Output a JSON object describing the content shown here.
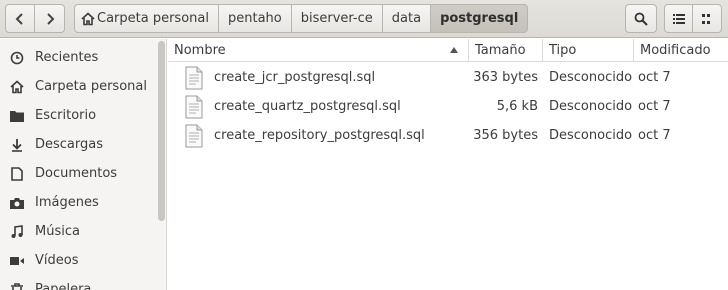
{
  "nav": {
    "back_icon": "chevron-left-icon",
    "forward_icon": "chevron-right-icon"
  },
  "path": [
    {
      "label": "Carpeta personal",
      "icon": "home-icon"
    },
    {
      "label": "pentaho"
    },
    {
      "label": "biserver-ce"
    },
    {
      "label": "data"
    },
    {
      "label": "postgresql"
    }
  ],
  "toolbar": {
    "search_icon": "search-icon",
    "list_icon": "list-view-icon",
    "menu_icon": "view-menu-icon"
  },
  "sidebar": {
    "items": [
      {
        "label": "Recientes",
        "icon": "clock-icon"
      },
      {
        "label": "Carpeta personal",
        "icon": "home-icon"
      },
      {
        "label": "Escritorio",
        "icon": "folder-icon"
      },
      {
        "label": "Descargas",
        "icon": "download-icon"
      },
      {
        "label": "Documentos",
        "icon": "document-icon"
      },
      {
        "label": "Imágenes",
        "icon": "camera-icon"
      },
      {
        "label": "Música",
        "icon": "music-icon"
      },
      {
        "label": "Vídeos",
        "icon": "video-icon"
      },
      {
        "label": "Papelera",
        "icon": "trash-icon"
      }
    ]
  },
  "columns": {
    "name": "Nombre",
    "size": "Tamaño",
    "type": "Tipo",
    "modified": "Modificado"
  },
  "files": [
    {
      "name": "create_jcr_postgresql.sql",
      "size": "363 bytes",
      "type": "Desconocido",
      "modified": "oct 7"
    },
    {
      "name": "create_quartz_postgresql.sql",
      "size": "5,6 kB",
      "type": "Desconocido",
      "modified": "oct 7"
    },
    {
      "name": "create_repository_postgresql.sql",
      "size": "356 bytes",
      "type": "Desconocido",
      "modified": "oct 7"
    }
  ]
}
